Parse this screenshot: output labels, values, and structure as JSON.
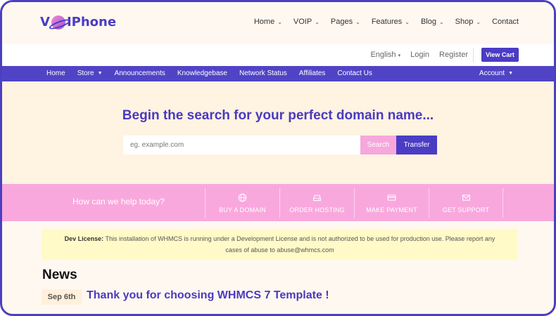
{
  "logo": {
    "prefix": "V",
    "suffix": "IPhone"
  },
  "main_nav": [
    {
      "label": "Home",
      "chevron": "⌄"
    },
    {
      "label": "VOIP",
      "chevron": "⌄"
    },
    {
      "label": "Pages",
      "chevron": "⌄"
    },
    {
      "label": "Features",
      "chevron": "⌄"
    },
    {
      "label": "Blog",
      "chevron": "⌄"
    },
    {
      "label": "Shop",
      "chevron": "⌄"
    },
    {
      "label": "Contact",
      "chevron": ""
    }
  ],
  "user_bar": {
    "language": "English",
    "login": "Login",
    "register": "Register",
    "view_cart": "View Cart"
  },
  "sub_nav": {
    "items": [
      {
        "label": "Home"
      },
      {
        "label": "Store",
        "dropdown": true
      },
      {
        "label": "Announcements"
      },
      {
        "label": "Knowledgebase"
      },
      {
        "label": "Network Status"
      },
      {
        "label": "Affiliates"
      },
      {
        "label": "Contact Us"
      }
    ],
    "account": "Account"
  },
  "hero": {
    "title": "Begin the search for your perfect domain name...",
    "search_placeholder": "eg. example.com",
    "search_button": "Search",
    "transfer_button": "Transfer"
  },
  "help": {
    "question": "How can we help today?",
    "actions": [
      {
        "label": "BUY A DOMAIN",
        "icon": "globe-icon"
      },
      {
        "label": "ORDER HOSTING",
        "icon": "server-icon"
      },
      {
        "label": "MAKE PAYMENT",
        "icon": "credit-card-icon"
      },
      {
        "label": "GET SUPPORT",
        "icon": "envelope-icon"
      }
    ]
  },
  "dev_license": {
    "label": "Dev License:",
    "text": "This installation of WHMCS is running under a Development License and is not authorized to be used for production use. Please report any cases of abuse to abuse@whmcs.com"
  },
  "news": {
    "heading": "News",
    "date": "Sep 6th",
    "headline": "Thank you for choosing WHMCS 7 Template !"
  },
  "colors": {
    "brand_purple": "#4b3cc4",
    "nav_purple": "#5043c5",
    "pink": "#f9a8de",
    "hero_bg": "#fff3e2",
    "notice_bg": "#fffac8"
  }
}
